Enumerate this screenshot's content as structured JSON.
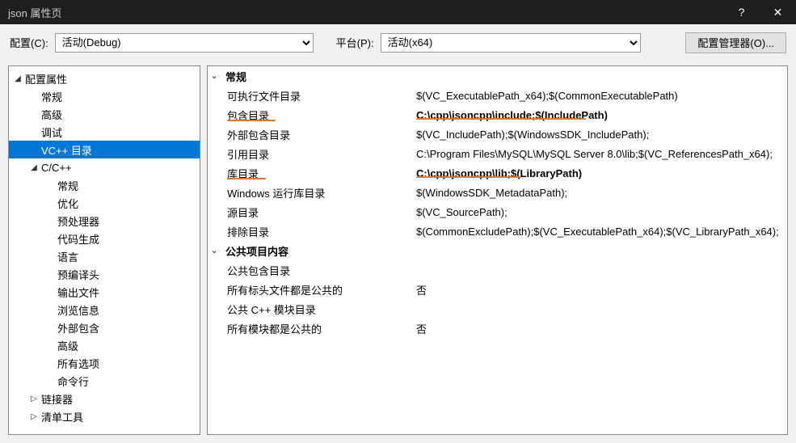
{
  "titlebar": {
    "title": "json 属性页",
    "help_symbol": "?",
    "close_symbol": "✕"
  },
  "toolbar": {
    "config_label": "配置(C):",
    "config_value": "活动(Debug)",
    "platform_label": "平台(P):",
    "platform_value": "活动(x64)",
    "config_mgr_label": "配置管理器(O)..."
  },
  "tree": [
    {
      "label": "配置属性",
      "depth": 0,
      "expanded": true,
      "hasChildren": true
    },
    {
      "label": "常规",
      "depth": 1,
      "hasChildren": false
    },
    {
      "label": "高级",
      "depth": 1,
      "hasChildren": false
    },
    {
      "label": "调试",
      "depth": 1,
      "hasChildren": false
    },
    {
      "label": "VC++ 目录",
      "depth": 1,
      "hasChildren": false,
      "selected": true
    },
    {
      "label": "C/C++",
      "depth": 1,
      "expanded": true,
      "hasChildren": true
    },
    {
      "label": "常规",
      "depth": 2,
      "hasChildren": false
    },
    {
      "label": "优化",
      "depth": 2,
      "hasChildren": false
    },
    {
      "label": "预处理器",
      "depth": 2,
      "hasChildren": false
    },
    {
      "label": "代码生成",
      "depth": 2,
      "hasChildren": false
    },
    {
      "label": "语言",
      "depth": 2,
      "hasChildren": false
    },
    {
      "label": "预编译头",
      "depth": 2,
      "hasChildren": false
    },
    {
      "label": "输出文件",
      "depth": 2,
      "hasChildren": false
    },
    {
      "label": "浏览信息",
      "depth": 2,
      "hasChildren": false
    },
    {
      "label": "外部包含",
      "depth": 2,
      "hasChildren": false
    },
    {
      "label": "高级",
      "depth": 2,
      "hasChildren": false
    },
    {
      "label": "所有选项",
      "depth": 2,
      "hasChildren": false
    },
    {
      "label": "命令行",
      "depth": 2,
      "hasChildren": false
    },
    {
      "label": "链接器",
      "depth": 1,
      "expanded": false,
      "hasChildren": true
    },
    {
      "label": "清单工具",
      "depth": 1,
      "expanded": false,
      "hasChildren": true
    }
  ],
  "props": {
    "groups": [
      {
        "title": "常规",
        "rows": [
          {
            "label": "可执行文件目录",
            "value": "$(VC_ExecutablePath_x64);$(CommonExecutablePath)"
          },
          {
            "label": "包含目录",
            "value": "C:\\cpp\\jsoncpp\\include;$(IncludePath)",
            "bold": true,
            "underlineLabel": 60,
            "underlineValue": 210
          },
          {
            "label": "外部包含目录",
            "value": "$(VC_IncludePath);$(WindowsSDK_IncludePath);"
          },
          {
            "label": "引用目录",
            "value": "C:\\Program Files\\MySQL\\MySQL Server 8.0\\lib;$(VC_ReferencesPath_x64);"
          },
          {
            "label": "库目录",
            "value": "C:\\cpp\\jsoncpp\\lib;$(LibraryPath)",
            "bold": true,
            "underlineLabel": 48,
            "underlineValue": 130
          },
          {
            "label": "Windows 运行库目录",
            "value": "$(WindowsSDK_MetadataPath);"
          },
          {
            "label": "源目录",
            "value": "$(VC_SourcePath);"
          },
          {
            "label": "排除目录",
            "value": "$(CommonExcludePath);$(VC_ExecutablePath_x64);$(VC_LibraryPath_x64);"
          }
        ]
      },
      {
        "title": "公共项目内容",
        "rows": [
          {
            "label": "公共包含目录",
            "value": ""
          },
          {
            "label": "所有标头文件都是公共的",
            "value": "否"
          },
          {
            "label": "公共 C++ 模块目录",
            "value": ""
          },
          {
            "label": "所有模块都是公共的",
            "value": "否"
          }
        ]
      }
    ]
  }
}
